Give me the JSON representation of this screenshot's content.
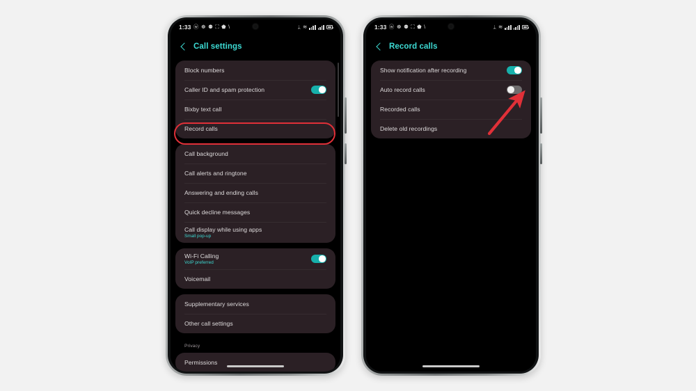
{
  "scene": {
    "background": "#f2f2f2",
    "accent_teal": "#3ddbd4",
    "annotation_red": "#e03038",
    "card_bg": "#2b2025"
  },
  "status_bar": {
    "time": "1:33",
    "left_icons": [
      "whatsapp-icon",
      "app-icon",
      "location-icon",
      "photos-icon",
      "app-icon-2",
      "backslash-icon"
    ],
    "right_icons": [
      "bluetooth-icon",
      "wifi-icon",
      "network-icon",
      "signal-icon",
      "battery-icon"
    ],
    "glyphs": {
      "whatsapp": "ⓦ",
      "app": "☸",
      "location": "⚉",
      "photos": "⛶",
      "app2": "⬟",
      "backslash": "\\",
      "bluetooth": "ᛦ",
      "wifi": "≋"
    }
  },
  "phones": [
    {
      "name": "call-settings-phone",
      "header": {
        "title": "Call settings",
        "back_icon": "back-chevron-icon"
      },
      "groups": [
        {
          "name": "group-blocking",
          "rows": [
            {
              "label": "Block numbers",
              "sub": null,
              "toggle": null,
              "highlighted": false
            },
            {
              "label": "Caller ID and spam protection",
              "sub": null,
              "toggle": "on",
              "highlighted": false
            },
            {
              "label": "Bixby text call",
              "sub": null,
              "toggle": null,
              "highlighted": false
            },
            {
              "label": "Record calls",
              "sub": null,
              "toggle": null,
              "highlighted": true
            }
          ]
        },
        {
          "name": "group-call-experience",
          "rows": [
            {
              "label": "Call background",
              "sub": null,
              "toggle": null,
              "highlighted": false
            },
            {
              "label": "Call alerts and ringtone",
              "sub": null,
              "toggle": null,
              "highlighted": false
            },
            {
              "label": "Answering and ending calls",
              "sub": null,
              "toggle": null,
              "highlighted": false
            },
            {
              "label": "Quick decline messages",
              "sub": null,
              "toggle": null,
              "highlighted": false
            },
            {
              "label": "Call display while using apps",
              "sub": "Small pop-up",
              "toggle": null,
              "highlighted": false
            }
          ]
        },
        {
          "name": "group-network",
          "rows": [
            {
              "label": "Wi-Fi Calling",
              "sub": "VoIP preferred",
              "toggle": "on",
              "highlighted": false
            },
            {
              "label": "Voicemail",
              "sub": null,
              "toggle": null,
              "highlighted": false
            }
          ]
        },
        {
          "name": "group-services",
          "rows": [
            {
              "label": "Supplementary services",
              "sub": null,
              "toggle": null,
              "highlighted": false
            },
            {
              "label": "Other call settings",
              "sub": null,
              "toggle": null,
              "highlighted": false
            }
          ]
        }
      ],
      "section_header": "Privacy",
      "trailing_group": {
        "name": "group-privacy",
        "rows": [
          {
            "label": "Permissions",
            "sub": null,
            "toggle": null,
            "highlighted": false
          }
        ]
      }
    },
    {
      "name": "record-calls-phone",
      "header": {
        "title": "Record calls",
        "back_icon": "back-chevron-icon"
      },
      "groups": [
        {
          "name": "group-record-calls",
          "rows": [
            {
              "label": "Show notification after recording",
              "sub": null,
              "toggle": "on",
              "highlighted": false
            },
            {
              "label": "Auto record calls",
              "sub": null,
              "toggle": "off",
              "highlighted": false,
              "arrow_target": true
            },
            {
              "label": "Recorded calls",
              "sub": null,
              "toggle": null,
              "highlighted": false
            },
            {
              "label": "Delete old recordings",
              "sub": null,
              "toggle": null,
              "highlighted": false
            }
          ]
        }
      ]
    }
  ],
  "annotations": {
    "oval": {
      "target": "Record calls",
      "color": "#e03038"
    },
    "arrow": {
      "target": "Auto record calls toggle",
      "color": "#e03038",
      "direction": "up-right"
    }
  }
}
